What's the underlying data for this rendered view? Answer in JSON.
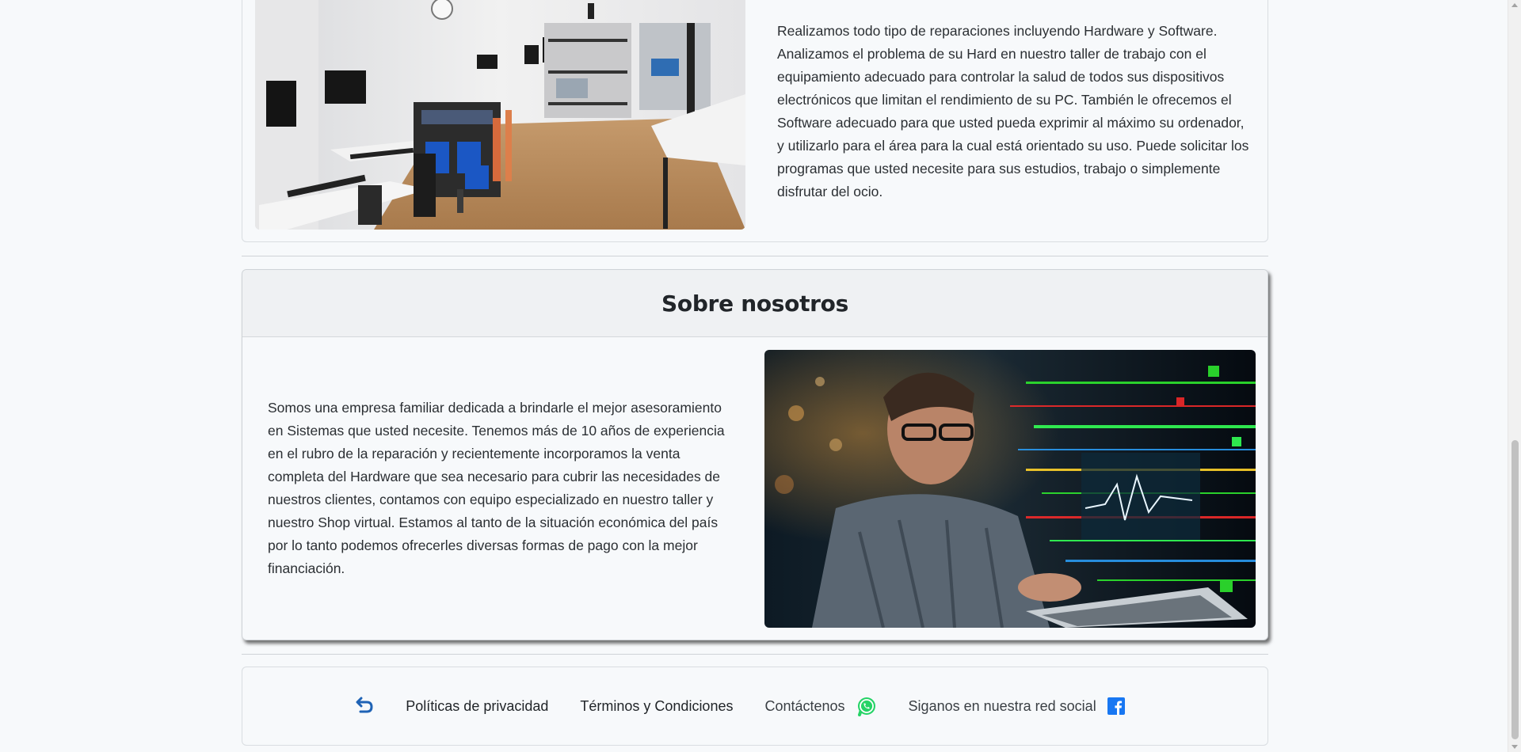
{
  "service": {
    "image_alt": "taller-de-reparacion",
    "text": "Realizamos todo tipo de reparaciones incluyendo Hardware y Software. Analizamos el problema de su Hard en nuestro taller de trabajo con el equipamiento adecuado para controlar la salud de todos sus dispositivos electrónicos que limitan el rendimiento de su PC. También le ofrecemos el Software adecuado para que usted pueda exprimir al máximo su ordenador, y utilizarlo para el área para la cual está orientado su uso. Puede solicitar los programas que usted necesite para sus estudios, trabajo o simplemente disfrutar del ocio."
  },
  "about": {
    "title": "Sobre nosotros",
    "text": "Somos una empresa familiar dedicada a brindarle el mejor asesoramiento en Sistemas que usted necesite. Tenemos más de 10 años de experiencia en el rubro de la reparación y recientemente incorporamos la venta completa del Hardware que sea necesario para cubrir las necesidades de nuestros clientes, contamos con equipo especializado en nuestro taller y nuestro Shop virtual. Estamos al tanto de la situación económica del país por lo tanto podemos ofrecerles diversas formas de pago con la mejor financiación."
  },
  "footer": {
    "back_icon": "return-arrow-icon",
    "privacy": "Políticas de privacidad",
    "terms": "Términos y Condiciones",
    "contact": "Contáctenos",
    "contact_icon": "whatsapp-icon",
    "social": "Siganos en nuestra red social",
    "social_icon": "facebook-icon"
  },
  "colors": {
    "page_bg": "#f7f9fb",
    "header_bg": "#eff1f3",
    "link_blue": "#1f63b5",
    "whatsapp_green": "#25d366",
    "facebook_blue": "#1877f2"
  }
}
